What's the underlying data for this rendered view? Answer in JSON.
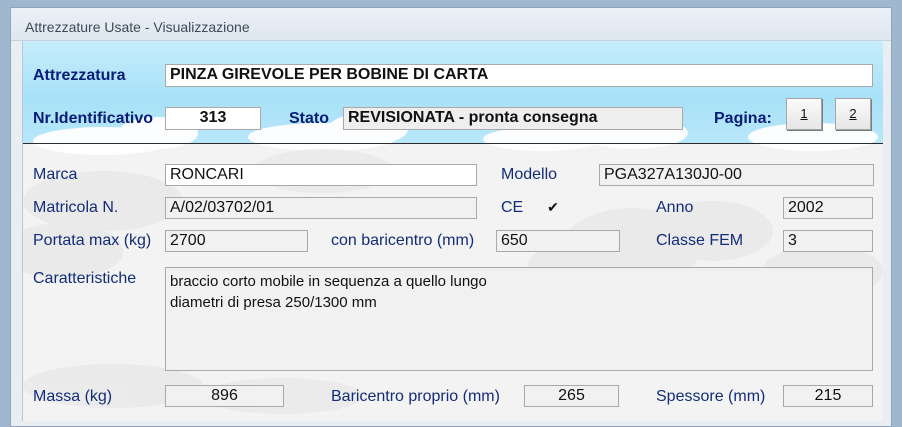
{
  "window": {
    "title": "Attrezzature Usate - Visualizzazione"
  },
  "header": {
    "attrezzatura_label": "Attrezzatura",
    "attrezzatura_value": "PINZA GIREVOLE PER BOBINE DI CARTA",
    "nr_label": "Nr.Identificativo",
    "nr_value": "313",
    "stato_label": "Stato",
    "stato_value": "REVISIONATA - pronta consegna",
    "pagina_label": "Pagina:",
    "page_buttons": [
      "1",
      "2"
    ]
  },
  "fields": {
    "marca_label": "Marca",
    "marca_value": "RONCARI",
    "modello_label": "Modello",
    "modello_value": "PGA327A130J0-00",
    "matricola_label": "Matricola N.",
    "matricola_value": "A/02/03702/01",
    "ce_label": "CE",
    "ce_checked": "✔",
    "anno_label": "Anno",
    "anno_value": "2002",
    "portata_label": "Portata max (kg)",
    "portata_value": "2700",
    "baricentro_label": "con baricentro (mm)",
    "baricentro_value": "650",
    "classe_label": "Classe FEM",
    "classe_value": "3",
    "caratteristiche_label": "Caratteristiche",
    "caratteristiche_line1": "braccio corto mobile in sequenza a quello lungo",
    "caratteristiche_line2": "diametri di presa 250/1300 mm",
    "massa_label": "Massa (kg)",
    "massa_value": "896",
    "baricentro_proprio_label": "Baricentro proprio (mm)",
    "baricentro_proprio_value": "265",
    "spessore_label": "Spessore (mm)",
    "spessore_value": "215"
  },
  "colors": {
    "label": "#132c7a",
    "sky": "#a8e1f8",
    "form_bg": "#f3f3f3"
  }
}
